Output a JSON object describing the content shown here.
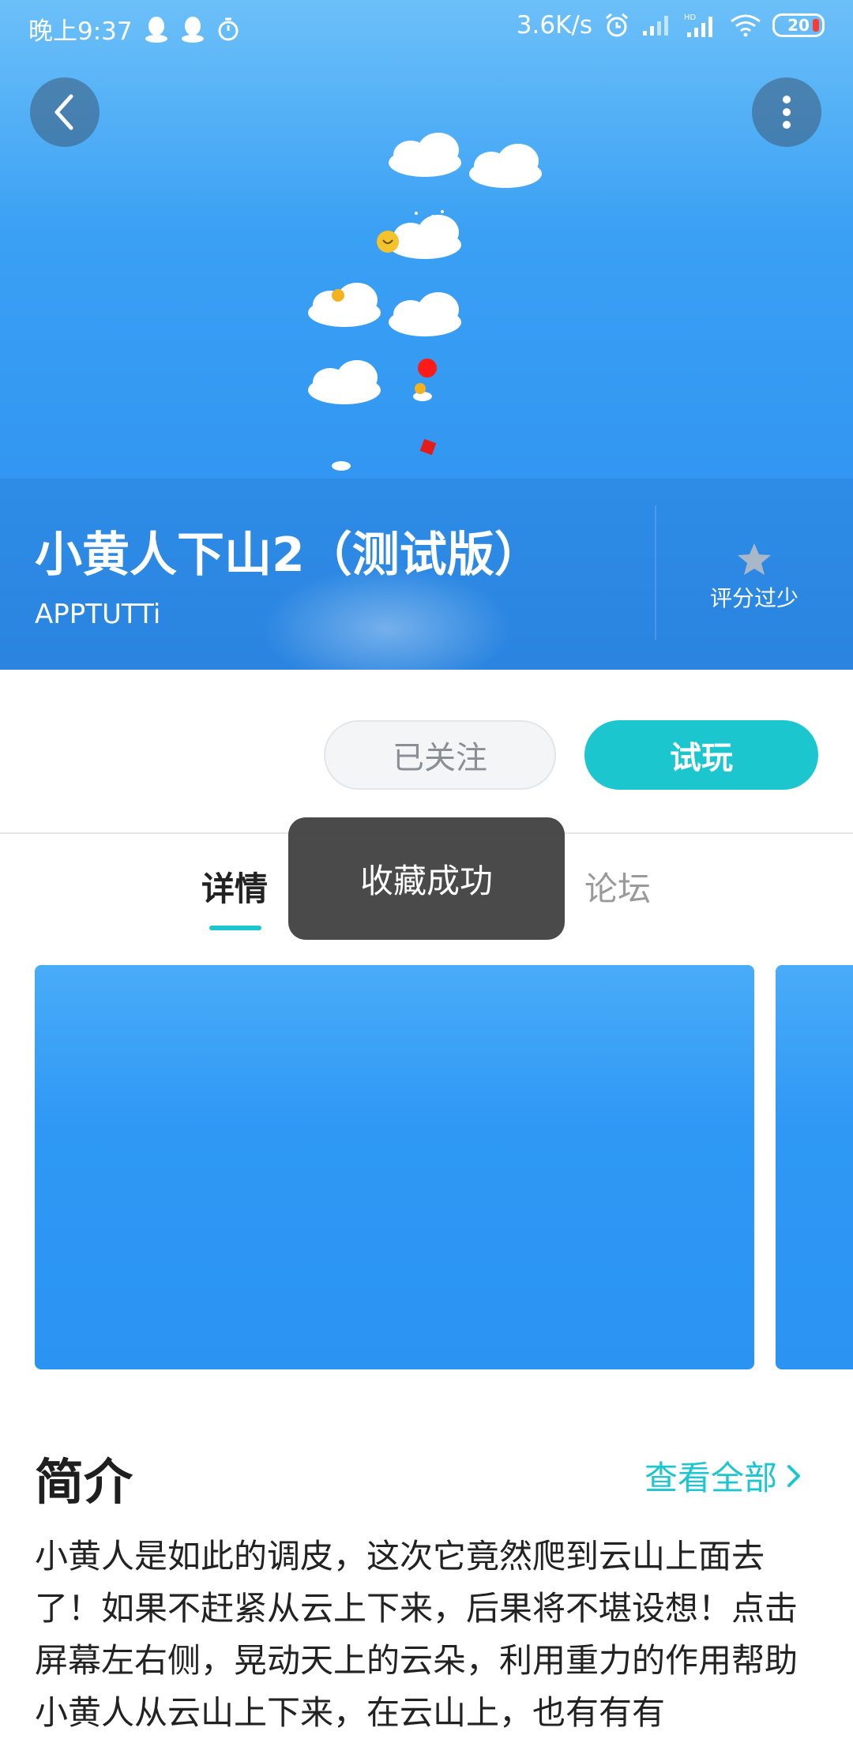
{
  "status_bar": {
    "time": "晚上9:37",
    "speed": "3.6K/s",
    "battery": "20"
  },
  "hero": {
    "title": "小黄人下山2（测试版）",
    "developer": "APPTUTTi",
    "rating_label": "评分过少"
  },
  "actions": {
    "followed_label": "已关注",
    "try_label": "试玩"
  },
  "tabs": {
    "detail": "详情",
    "forum": "论坛"
  },
  "toast": {
    "message": "收藏成功"
  },
  "intro": {
    "title": "简介",
    "see_all": "查看全部",
    "text": "小黄人是如此的调皮，这次它竟然爬到云山上面去了！如果不赶紧从云上下来，后果将不堪设想！点击屏幕左右侧，晃动天上的云朵，利用重力的作用帮助小黄人从云山上下来，在云山上，也有有有"
  },
  "colors": {
    "accent": "#1cc6cf",
    "hero_blue": "#2c8ff0"
  }
}
